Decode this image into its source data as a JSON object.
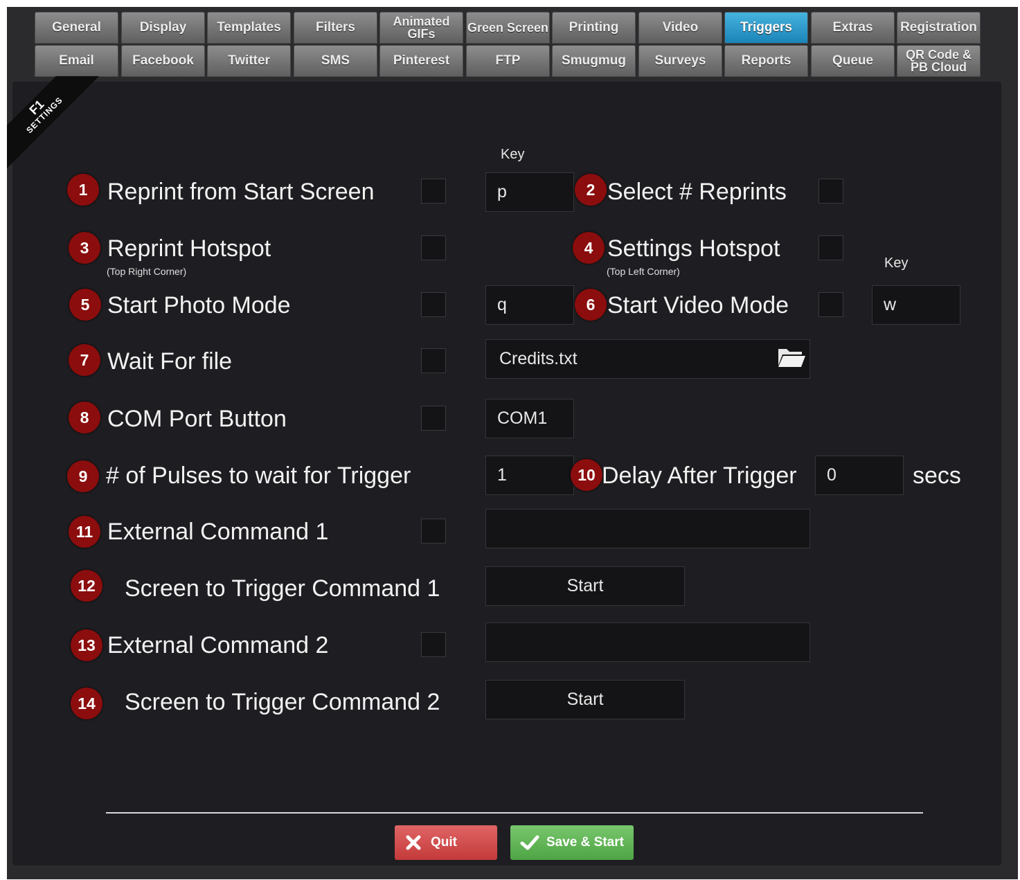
{
  "tabs": {
    "row1": [
      "General",
      "Display",
      "Templates",
      "Filters",
      "Animated GIFs",
      "Green Screen",
      "Printing",
      "Video",
      "Triggers",
      "Extras",
      "Registration"
    ],
    "row2": [
      "Email",
      "Facebook",
      "Twitter",
      "SMS",
      "Pinterest",
      "FTP",
      "Smugmug",
      "Surveys",
      "Reports",
      "Queue",
      "QR Code & PB Cloud"
    ],
    "active": "Triggers"
  },
  "corner": {
    "key": "F1",
    "label": "SETTINGS"
  },
  "key_header": "Key",
  "rows": {
    "r1": {
      "num": "1",
      "label": "Reprint from Start Screen",
      "key": "p",
      "checked": false
    },
    "r2": {
      "num": "2",
      "label": "Select # Reprints",
      "checked": false
    },
    "r3": {
      "num": "3",
      "label": "Reprint Hotspot",
      "sub": "(Top Right Corner)",
      "checked": false
    },
    "r4": {
      "num": "4",
      "label": "Settings Hotspot",
      "sub": "(Top Left Corner)",
      "checked": false
    },
    "r5": {
      "num": "5",
      "label": "Start Photo Mode",
      "key": "q",
      "checked": false
    },
    "r6": {
      "num": "6",
      "label": "Start Video Mode",
      "key": "w",
      "checked": false
    },
    "r7": {
      "num": "7",
      "label": "Wait For file",
      "file": "Credits.txt",
      "checked": false
    },
    "r8": {
      "num": "8",
      "label": "COM Port Button",
      "port": "COM1",
      "checked": false
    },
    "r9": {
      "num": "9",
      "label": "# of Pulses to wait for Trigger",
      "value": "1"
    },
    "r10": {
      "num": "10",
      "label": "Delay After Trigger",
      "value": "0",
      "unit": "secs"
    },
    "r11": {
      "num": "11",
      "label": "External Command 1",
      "value": "",
      "checked": false
    },
    "r12": {
      "num": "12",
      "label": "Screen to Trigger Command 1",
      "value": "Start"
    },
    "r13": {
      "num": "13",
      "label": "External Command 2",
      "value": "",
      "checked": false
    },
    "r14": {
      "num": "14",
      "label": "Screen to Trigger Command 2",
      "value": "Start"
    }
  },
  "buttons": {
    "quit": "Quit",
    "save": "Save & Start"
  },
  "colors": {
    "badge": "#8b0d0d",
    "active_tab": "#2a9ccf",
    "quit": "#d34c4c",
    "save": "#5fb354"
  }
}
